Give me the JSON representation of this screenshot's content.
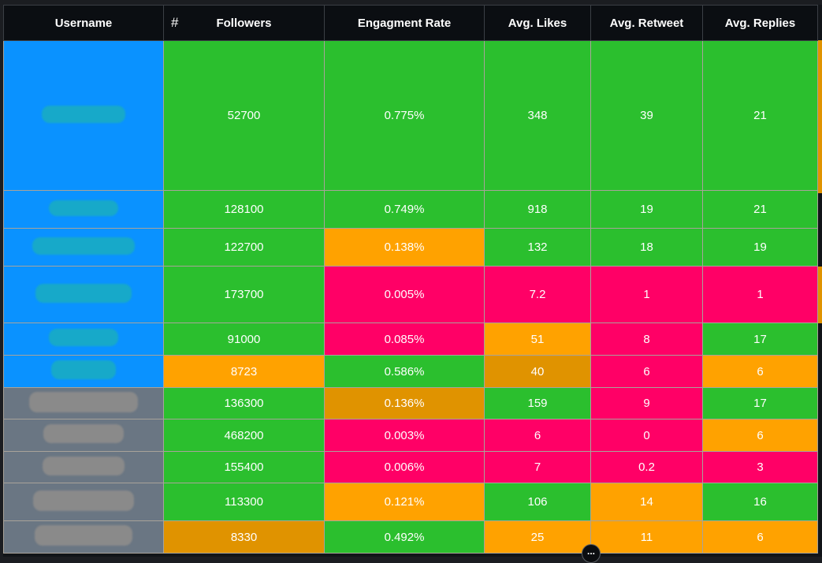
{
  "headers": {
    "username": "Username",
    "hash": "#",
    "followers": "Followers",
    "engagement": "Engagment Rate",
    "likes": "Avg. Likes",
    "retweet": "Avg. Retweet",
    "replies": "Avg. Replies"
  },
  "colors": {
    "green": "#2bbf2e",
    "orange": "#ffa200",
    "dark_orange": "#e09300",
    "red": "#ff0066",
    "blue": "#0a92ff",
    "slate": "#6a7683",
    "header_bg": "#0b0e12"
  },
  "rows": [
    {
      "user_color": "#0a92ff",
      "blur": "teal",
      "followers": "52700",
      "followers_color": "#2bbf2e",
      "engagement": "0.775%",
      "engagement_color": "#2bbf2e",
      "likes": "348",
      "likes_color": "#2bbf2e",
      "retweet": "39",
      "retweet_color": "#2bbf2e",
      "replies": "21",
      "replies_color": "#2bbf2e"
    },
    {
      "user_color": "#0a92ff",
      "blur": "teal",
      "followers": "128100",
      "followers_color": "#2bbf2e",
      "engagement": "0.749%",
      "engagement_color": "#2bbf2e",
      "likes": "918",
      "likes_color": "#2bbf2e",
      "retweet": "19",
      "retweet_color": "#2bbf2e",
      "replies": "21",
      "replies_color": "#2bbf2e"
    },
    {
      "user_color": "#0a92ff",
      "blur": "teal",
      "followers": "122700",
      "followers_color": "#2bbf2e",
      "engagement": "0.138%",
      "engagement_color": "#ffa200",
      "likes": "132",
      "likes_color": "#2bbf2e",
      "retweet": "18",
      "retweet_color": "#2bbf2e",
      "replies": "19",
      "replies_color": "#2bbf2e"
    },
    {
      "user_color": "#0a92ff",
      "blur": "teal",
      "followers": "173700",
      "followers_color": "#2bbf2e",
      "engagement": "0.005%",
      "engagement_color": "#ff0066",
      "likes": "7.2",
      "likes_color": "#ff0066",
      "retweet": "1",
      "retweet_color": "#ff0066",
      "replies": "1",
      "replies_color": "#ff0066"
    },
    {
      "user_color": "#0a92ff",
      "blur": "teal",
      "followers": "91000",
      "followers_color": "#2bbf2e",
      "engagement": "0.085%",
      "engagement_color": "#ff0066",
      "likes": "51",
      "likes_color": "#ffa200",
      "retweet": "8",
      "retweet_color": "#ff0066",
      "replies": "17",
      "replies_color": "#2bbf2e"
    },
    {
      "user_color": "#0a92ff",
      "blur": "teal",
      "followers": "8723",
      "followers_color": "#ffa200",
      "engagement": "0.586%",
      "engagement_color": "#2bbf2e",
      "likes": "40",
      "likes_color": "#e09300",
      "retweet": "6",
      "retweet_color": "#ff0066",
      "replies": "6",
      "replies_color": "#ffa200"
    },
    {
      "user_color": "#6a7683",
      "blur": "grey",
      "followers": "136300",
      "followers_color": "#2bbf2e",
      "engagement": "0.136%",
      "engagement_color": "#e09300",
      "likes": "159",
      "likes_color": "#2bbf2e",
      "retweet": "9",
      "retweet_color": "#ff0066",
      "replies": "17",
      "replies_color": "#2bbf2e"
    },
    {
      "user_color": "#6a7683",
      "blur": "grey",
      "followers": "468200",
      "followers_color": "#2bbf2e",
      "engagement": "0.003%",
      "engagement_color": "#ff0066",
      "likes": "6",
      "likes_color": "#ff0066",
      "retweet": "0",
      "retweet_color": "#ff0066",
      "replies": "6",
      "replies_color": "#ffa200"
    },
    {
      "user_color": "#6a7683",
      "blur": "grey",
      "followers": "155400",
      "followers_color": "#2bbf2e",
      "engagement": "0.006%",
      "engagement_color": "#ff0066",
      "likes": "7",
      "likes_color": "#ff0066",
      "retweet": "0.2",
      "retweet_color": "#ff0066",
      "replies": "3",
      "replies_color": "#ff0066"
    },
    {
      "user_color": "#6a7683",
      "blur": "grey",
      "followers": "113300",
      "followers_color": "#2bbf2e",
      "engagement": "0.121%",
      "engagement_color": "#ffa200",
      "likes": "106",
      "likes_color": "#2bbf2e",
      "retweet": "14",
      "retweet_color": "#ffa200",
      "replies": "16",
      "replies_color": "#2bbf2e"
    },
    {
      "user_color": "#6a7683",
      "blur": "grey",
      "followers": "8330",
      "followers_color": "#e09300",
      "engagement": "0.492%",
      "engagement_color": "#2bbf2e",
      "likes": "25",
      "likes_color": "#ffa200",
      "retweet": "11",
      "retweet_color": "#ffa200",
      "replies": "6",
      "replies_color": "#ffa200"
    }
  ],
  "more_button": "..."
}
